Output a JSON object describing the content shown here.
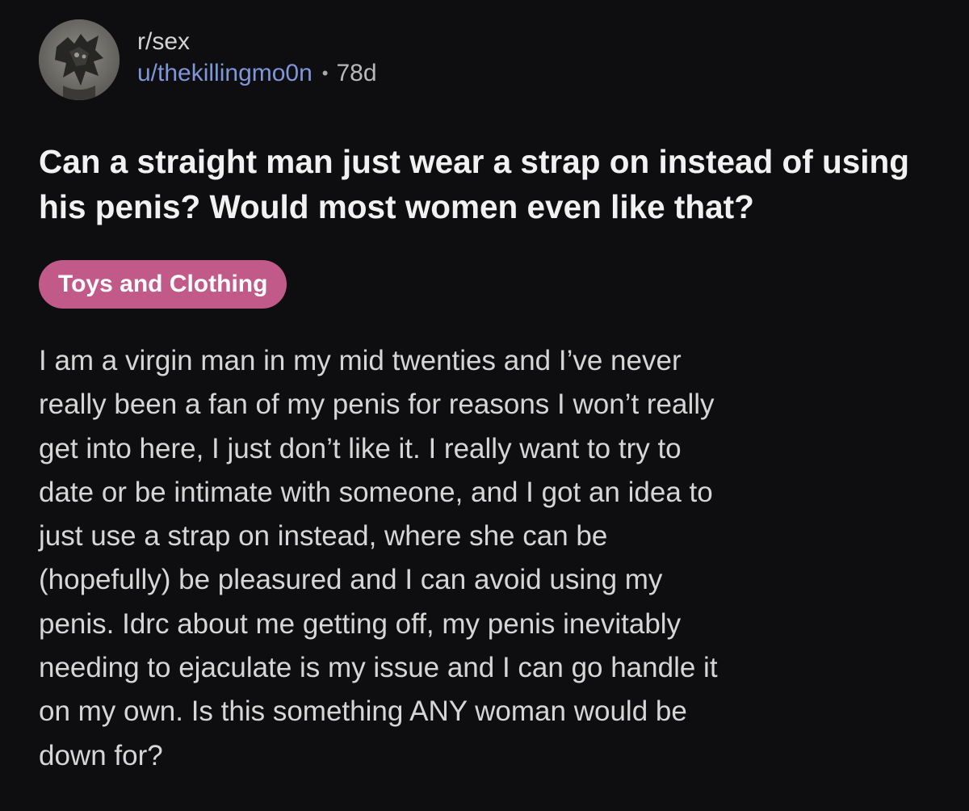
{
  "post": {
    "subreddit": "r/sex",
    "username": "u/thekillingmo0n",
    "separator": "•",
    "age": "78d",
    "avatar_icon": "profile-avatar-icon",
    "title": "Can a straight man just wear a strap on instead of using his penis? Would most women even like that?",
    "flair": "Toys and Clothing",
    "body": "I am a virgin man in my mid twenties and I’ve never\nreally been a fan of my penis for reasons I won’t really\nget into here, I just don’t like it. I really want to try to\ndate or be intimate with someone, and I got an idea to\njust use a strap on instead, where she can be\n(hopefully) be pleasured and I can avoid using my\npenis. Idrc about me getting off, my penis inevitably\nneeding to ejaculate is my issue and I can go handle it\non my own. Is this something ANY woman would be\ndown for?"
  },
  "colors": {
    "background": "#0e0e10",
    "username": "#7f97d9",
    "flair_background": "#c25a89",
    "title": "#f1f1f1",
    "body": "#d6d6d6"
  }
}
